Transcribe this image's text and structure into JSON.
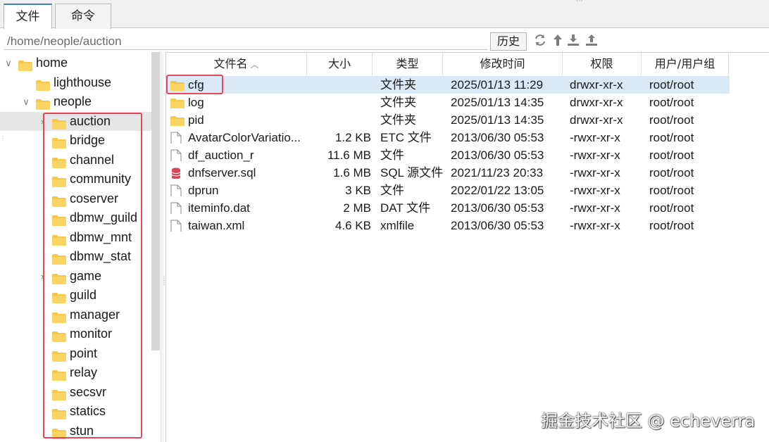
{
  "tabs": [
    {
      "label": "文件",
      "active": true
    },
    {
      "label": "命令",
      "active": false
    }
  ],
  "pathbar": {
    "path": "/home/neople/auction",
    "history_label": "历史",
    "tools": [
      "refresh-icon",
      "up-arrow-icon",
      "download-icon",
      "upload-icon"
    ]
  },
  "tree": {
    "items": [
      {
        "label": "home",
        "depth": 0,
        "expander": "open"
      },
      {
        "label": "lighthouse",
        "depth": 1,
        "expander": "none"
      },
      {
        "label": "neople",
        "depth": 1,
        "expander": "open"
      },
      {
        "label": "auction",
        "depth": 2,
        "expander": "closed",
        "selected": true
      },
      {
        "label": "bridge",
        "depth": 2,
        "expander": "none"
      },
      {
        "label": "channel",
        "depth": 2,
        "expander": "none"
      },
      {
        "label": "community",
        "depth": 2,
        "expander": "none"
      },
      {
        "label": "coserver",
        "depth": 2,
        "expander": "none"
      },
      {
        "label": "dbmw_guild",
        "depth": 2,
        "expander": "none"
      },
      {
        "label": "dbmw_mnt",
        "depth": 2,
        "expander": "none"
      },
      {
        "label": "dbmw_stat",
        "depth": 2,
        "expander": "none"
      },
      {
        "label": "game",
        "depth": 2,
        "expander": "closed"
      },
      {
        "label": "guild",
        "depth": 2,
        "expander": "none"
      },
      {
        "label": "manager",
        "depth": 2,
        "expander": "none"
      },
      {
        "label": "monitor",
        "depth": 2,
        "expander": "none"
      },
      {
        "label": "point",
        "depth": 2,
        "expander": "none"
      },
      {
        "label": "relay",
        "depth": 2,
        "expander": "none"
      },
      {
        "label": "secsvr",
        "depth": 2,
        "expander": "none"
      },
      {
        "label": "statics",
        "depth": 2,
        "expander": "none"
      },
      {
        "label": "stun",
        "depth": 2,
        "expander": "none"
      }
    ]
  },
  "files": {
    "columns": {
      "name": "文件名",
      "size": "大小",
      "type": "类型",
      "modified": "修改时间",
      "permissions": "权限",
      "owner": "用户/用户组"
    },
    "rows": [
      {
        "icon": "folder-icon",
        "name": "cfg",
        "size": "",
        "type": "文件夹",
        "modified": "2025/01/13 11:29",
        "permissions": "drwxr-xr-x",
        "owner": "root/root",
        "selected": true
      },
      {
        "icon": "folder-icon",
        "name": "log",
        "size": "",
        "type": "文件夹",
        "modified": "2025/01/13 14:35",
        "permissions": "drwxr-xr-x",
        "owner": "root/root"
      },
      {
        "icon": "folder-icon",
        "name": "pid",
        "size": "",
        "type": "文件夹",
        "modified": "2025/01/13 14:35",
        "permissions": "drwxr-xr-x",
        "owner": "root/root"
      },
      {
        "icon": "file-icon",
        "name": "AvatarColorVariatio...",
        "size": "1.2 KB",
        "type": "ETC 文件",
        "modified": "2013/06/30 05:53",
        "permissions": "-rwxr-xr-x",
        "owner": "root/root"
      },
      {
        "icon": "file-icon",
        "name": "df_auction_r",
        "size": "11.6 MB",
        "type": "文件",
        "modified": "2013/06/30 05:53",
        "permissions": "-rwxr-xr-x",
        "owner": "root/root"
      },
      {
        "icon": "database-file-icon",
        "name": "dnfserver.sql",
        "size": "1.6 MB",
        "type": "SQL 源文件",
        "modified": "2021/11/23 20:33",
        "permissions": "-rwxr-xr-x",
        "owner": "root/root"
      },
      {
        "icon": "file-icon",
        "name": "dprun",
        "size": "3 KB",
        "type": "文件",
        "modified": "2022/01/22 13:05",
        "permissions": "-rwxr-xr-x",
        "owner": "root/root"
      },
      {
        "icon": "file-icon",
        "name": "iteminfo.dat",
        "size": "2 MB",
        "type": "DAT 文件",
        "modified": "2013/06/30 05:53",
        "permissions": "-rwxr-xr-x",
        "owner": "root/root"
      },
      {
        "icon": "file-icon",
        "name": "taiwan.xml",
        "size": "4.6 KB",
        "type": "xmlfile",
        "modified": "2013/06/30 05:53",
        "permissions": "-rwxr-xr-x",
        "owner": "root/root"
      }
    ]
  },
  "watermark": "掘金技术社区 @ echeverra",
  "colors": {
    "folder": "#f5c84c",
    "selection_blue": "#dbe9f7",
    "highlight_red": "#e6475f",
    "tab_accent": "#3a7bd5"
  }
}
